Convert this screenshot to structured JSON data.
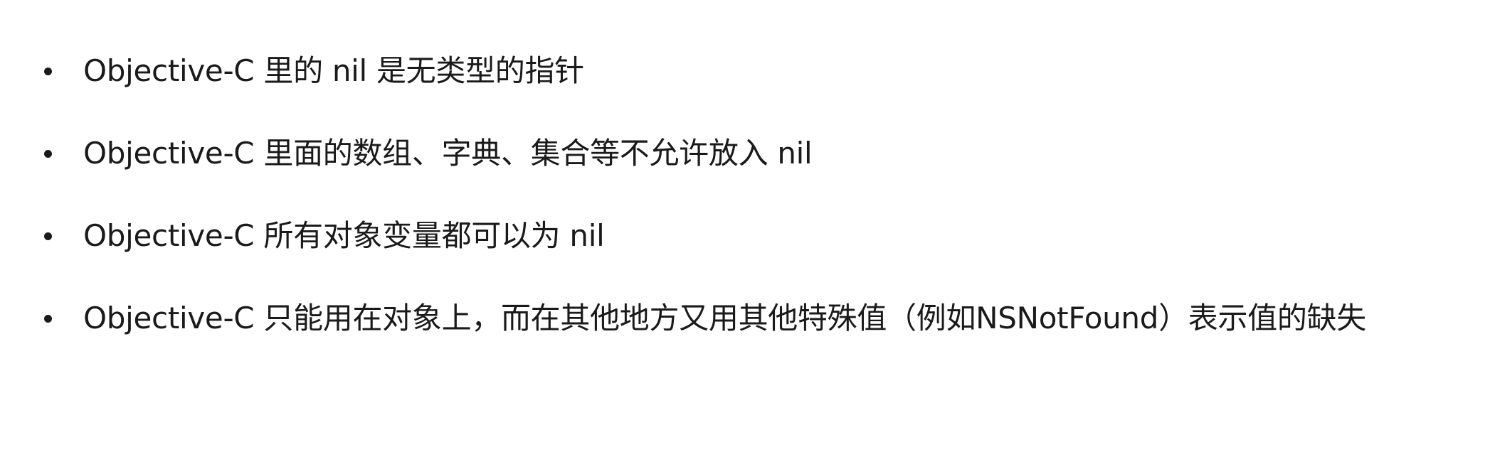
{
  "bullets": [
    "Objective-C 里的 nil 是无类型的指针",
    "Objective-C 里面的数组、字典、集合等不允许放入 nil",
    "Objective-C 所有对象变量都可以为 nil",
    "Objective-C 只能用在对象上，而在其他地方又用其他特殊值（例如NSNotFound）表示值的缺失"
  ]
}
